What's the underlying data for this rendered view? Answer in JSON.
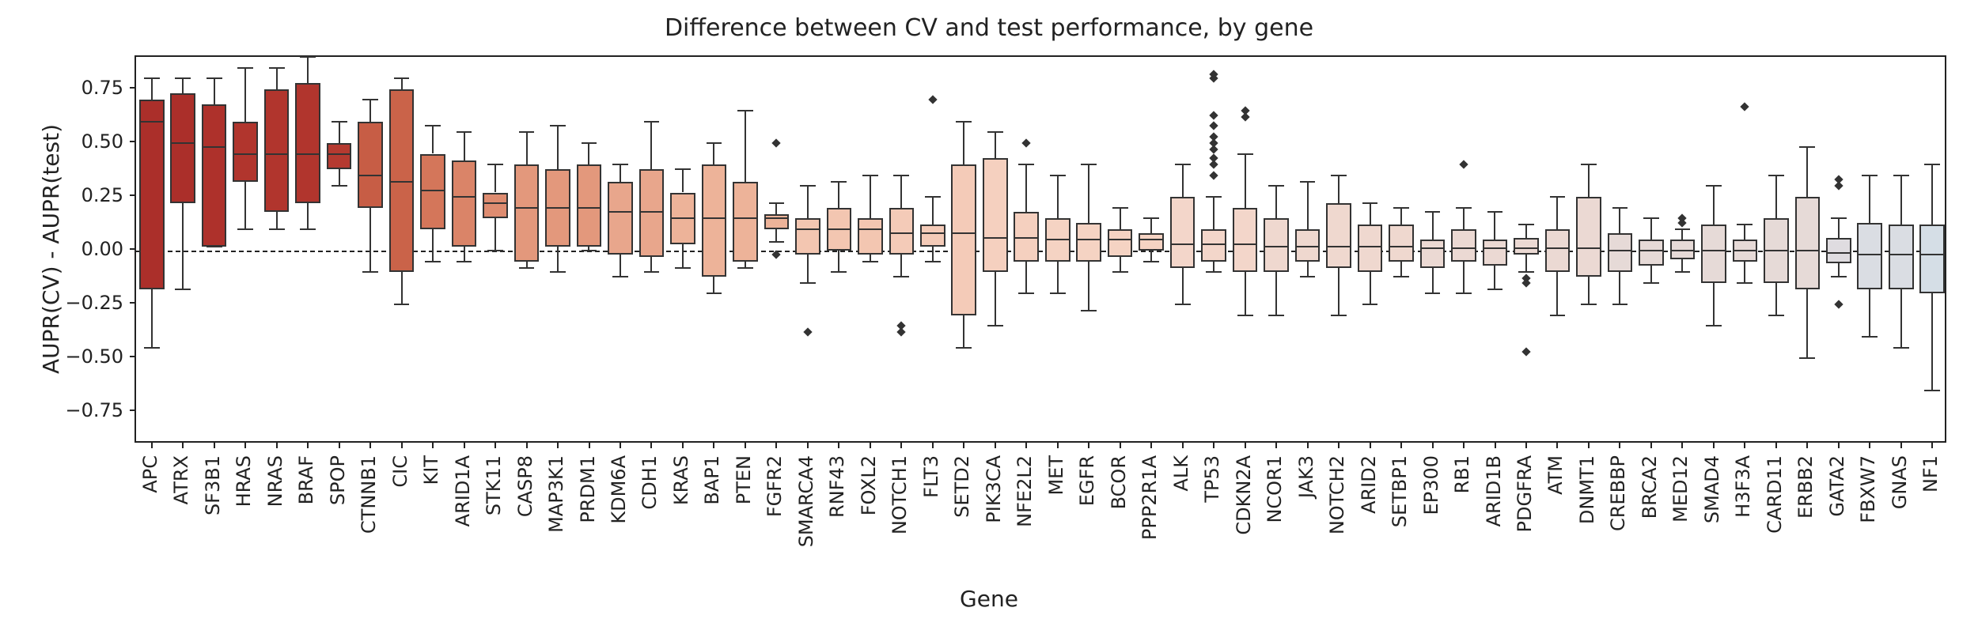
{
  "chart_data": {
    "type": "boxplot",
    "title": "Difference between CV and test performance, by gene",
    "xlabel": "Gene",
    "ylabel": "AUPR(CV) - AUPR(test)",
    "ylim": [
      -0.9,
      0.9
    ],
    "yticks": [
      -0.75,
      -0.5,
      -0.25,
      0.0,
      0.25,
      0.5,
      0.75
    ],
    "ytick_labels": [
      "−0.75",
      "−0.50",
      "−0.25",
      "0.00",
      "0.25",
      "0.50",
      "0.75"
    ],
    "categories": [
      "APC",
      "ATRX",
      "SF3B1",
      "HRAS",
      "NRAS",
      "BRAF",
      "SPOP",
      "CTNNB1",
      "CIC",
      "KIT",
      "ARID1A",
      "STK11",
      "CASP8",
      "MAP3K1",
      "PRDM1",
      "KDM6A",
      "CDH1",
      "KRAS",
      "BAP1",
      "PTEN",
      "FGFR2",
      "SMARCA4",
      "RNF43",
      "FOXL2",
      "NOTCH1",
      "FLT3",
      "SETD2",
      "PIK3CA",
      "NFE2L2",
      "MET",
      "EGFR",
      "BCOR",
      "PPP2R1A",
      "ALK",
      "TP53",
      "CDKN2A",
      "NCOR1",
      "JAK3",
      "NOTCH2",
      "ARID2",
      "SETBP1",
      "EP300",
      "RB1",
      "ARID1B",
      "PDGFRA",
      "ATM",
      "DNMT1",
      "CREBBP",
      "BRCA2",
      "MED12",
      "SMAD4",
      "H3F3A",
      "CARD11",
      "ERBB2",
      "GATA2",
      "FBXW7",
      "GNAS",
      "NF1"
    ],
    "series": [
      {
        "lw": -0.45,
        "q1": -0.18,
        "med": 0.6,
        "q3": 0.7,
        "uw": 0.8,
        "outliers": [],
        "color": "#ab2f2a"
      },
      {
        "lw": -0.18,
        "q1": 0.22,
        "med": 0.5,
        "q3": 0.73,
        "uw": 0.8,
        "outliers": [],
        "color": "#ab2f2a"
      },
      {
        "lw": 0.02,
        "q1": 0.02,
        "med": 0.48,
        "q3": 0.68,
        "uw": 0.8,
        "outliers": [],
        "color": "#ae312b"
      },
      {
        "lw": 0.1,
        "q1": 0.32,
        "med": 0.45,
        "q3": 0.6,
        "uw": 0.85,
        "outliers": [],
        "color": "#b1352d"
      },
      {
        "lw": 0.1,
        "q1": 0.18,
        "med": 0.45,
        "q3": 0.75,
        "uw": 0.85,
        "outliers": [],
        "color": "#b1352d"
      },
      {
        "lw": 0.1,
        "q1": 0.22,
        "med": 0.45,
        "q3": 0.78,
        "uw": 0.9,
        "outliers": [],
        "color": "#b1352d"
      },
      {
        "lw": 0.3,
        "q1": 0.38,
        "med": 0.45,
        "q3": 0.5,
        "uw": 0.6,
        "outliers": [],
        "color": "#b53a30"
      },
      {
        "lw": -0.1,
        "q1": 0.2,
        "med": 0.35,
        "q3": 0.6,
        "uw": 0.7,
        "outliers": [],
        "color": "#c75d45"
      },
      {
        "lw": -0.25,
        "q1": -0.1,
        "med": 0.32,
        "q3": 0.75,
        "uw": 0.8,
        "outliers": [],
        "color": "#ca6349"
      },
      {
        "lw": -0.05,
        "q1": 0.1,
        "med": 0.28,
        "q3": 0.45,
        "uw": 0.58,
        "outliers": [],
        "color": "#d4765a"
      },
      {
        "lw": -0.05,
        "q1": 0.02,
        "med": 0.25,
        "q3": 0.42,
        "uw": 0.55,
        "outliers": [],
        "color": "#da8468"
      },
      {
        "lw": 0.0,
        "q1": 0.15,
        "med": 0.22,
        "q3": 0.27,
        "uw": 0.4,
        "outliers": [],
        "color": "#de8c70"
      },
      {
        "lw": -0.08,
        "q1": -0.05,
        "med": 0.2,
        "q3": 0.4,
        "uw": 0.55,
        "outliers": [],
        "color": "#e3987c"
      },
      {
        "lw": -0.1,
        "q1": 0.02,
        "med": 0.2,
        "q3": 0.38,
        "uw": 0.58,
        "outliers": [],
        "color": "#e3987c"
      },
      {
        "lw": 0.0,
        "q1": 0.02,
        "med": 0.2,
        "q3": 0.4,
        "uw": 0.5,
        "outliers": [],
        "color": "#e3987c"
      },
      {
        "lw": -0.12,
        "q1": -0.02,
        "med": 0.18,
        "q3": 0.32,
        "uw": 0.4,
        "outliers": [],
        "color": "#e8a68c"
      },
      {
        "lw": -0.1,
        "q1": -0.03,
        "med": 0.18,
        "q3": 0.38,
        "uw": 0.6,
        "outliers": [],
        "color": "#e8a68c"
      },
      {
        "lw": -0.08,
        "q1": 0.03,
        "med": 0.15,
        "q3": 0.27,
        "uw": 0.38,
        "outliers": [],
        "color": "#edb399"
      },
      {
        "lw": -0.2,
        "q1": -0.12,
        "med": 0.15,
        "q3": 0.4,
        "uw": 0.5,
        "outliers": [],
        "color": "#edb399"
      },
      {
        "lw": -0.08,
        "q1": -0.05,
        "med": 0.15,
        "q3": 0.32,
        "uw": 0.65,
        "outliers": [],
        "color": "#edb399"
      },
      {
        "lw": 0.04,
        "q1": 0.1,
        "med": 0.15,
        "q3": 0.17,
        "uw": 0.22,
        "outliers": [
          -0.02,
          0.5
        ],
        "color": "#edb399"
      },
      {
        "lw": -0.15,
        "q1": -0.02,
        "med": 0.1,
        "q3": 0.15,
        "uw": 0.3,
        "outliers": [
          -0.38
        ],
        "color": "#f3c6b1"
      },
      {
        "lw": -0.1,
        "q1": 0.0,
        "med": 0.1,
        "q3": 0.2,
        "uw": 0.32,
        "outliers": [],
        "color": "#f3c6b1"
      },
      {
        "lw": -0.05,
        "q1": -0.02,
        "med": 0.1,
        "q3": 0.15,
        "uw": 0.35,
        "outliers": [],
        "color": "#f3c6b1"
      },
      {
        "lw": -0.12,
        "q1": -0.02,
        "med": 0.08,
        "q3": 0.2,
        "uw": 0.35,
        "outliers": [
          -0.38,
          -0.35
        ],
        "color": "#f4cbb8"
      },
      {
        "lw": -0.05,
        "q1": 0.02,
        "med": 0.08,
        "q3": 0.12,
        "uw": 0.25,
        "outliers": [
          0.7
        ],
        "color": "#f4cbb8"
      },
      {
        "lw": -0.45,
        "q1": -0.3,
        "med": 0.08,
        "q3": 0.4,
        "uw": 0.6,
        "outliers": [],
        "color": "#f4cbb8"
      },
      {
        "lw": -0.35,
        "q1": -0.1,
        "med": 0.06,
        "q3": 0.43,
        "uw": 0.55,
        "outliers": [],
        "color": "#f5d0bf"
      },
      {
        "lw": -0.2,
        "q1": -0.05,
        "med": 0.06,
        "q3": 0.18,
        "uw": 0.4,
        "outliers": [
          0.5
        ],
        "color": "#f5d0bf"
      },
      {
        "lw": -0.2,
        "q1": -0.05,
        "med": 0.05,
        "q3": 0.15,
        "uw": 0.35,
        "outliers": [],
        "color": "#f5d3c3"
      },
      {
        "lw": -0.28,
        "q1": -0.05,
        "med": 0.05,
        "q3": 0.13,
        "uw": 0.4,
        "outliers": [],
        "color": "#f5d3c3"
      },
      {
        "lw": -0.1,
        "q1": -0.03,
        "med": 0.05,
        "q3": 0.1,
        "uw": 0.2,
        "outliers": [],
        "color": "#f5d3c3"
      },
      {
        "lw": -0.05,
        "q1": 0.0,
        "med": 0.05,
        "q3": 0.08,
        "uw": 0.15,
        "outliers": [],
        "color": "#f5d3c3"
      },
      {
        "lw": -0.25,
        "q1": -0.08,
        "med": 0.03,
        "q3": 0.25,
        "uw": 0.4,
        "outliers": [],
        "color": "#f3d6ca"
      },
      {
        "lw": -0.1,
        "q1": -0.05,
        "med": 0.03,
        "q3": 0.1,
        "uw": 0.25,
        "outliers": [
          0.35,
          0.4,
          0.43,
          0.47,
          0.5,
          0.53,
          0.58,
          0.63,
          0.8,
          0.82
        ],
        "color": "#f3d6ca"
      },
      {
        "lw": -0.3,
        "q1": -0.1,
        "med": 0.03,
        "q3": 0.2,
        "uw": 0.45,
        "outliers": [
          0.62,
          0.65
        ],
        "color": "#f3d6ca"
      },
      {
        "lw": -0.3,
        "q1": -0.1,
        "med": 0.02,
        "q3": 0.15,
        "uw": 0.3,
        "outliers": [],
        "color": "#efd8cf"
      },
      {
        "lw": -0.12,
        "q1": -0.05,
        "med": 0.02,
        "q3": 0.1,
        "uw": 0.32,
        "outliers": [],
        "color": "#efd8cf"
      },
      {
        "lw": -0.3,
        "q1": -0.08,
        "med": 0.02,
        "q3": 0.22,
        "uw": 0.35,
        "outliers": [],
        "color": "#efd8cf"
      },
      {
        "lw": -0.25,
        "q1": -0.1,
        "med": 0.02,
        "q3": 0.12,
        "uw": 0.22,
        "outliers": [],
        "color": "#efd8cf"
      },
      {
        "lw": -0.12,
        "q1": -0.05,
        "med": 0.02,
        "q3": 0.12,
        "uw": 0.2,
        "outliers": [],
        "color": "#efd8cf"
      },
      {
        "lw": -0.2,
        "q1": -0.08,
        "med": 0.01,
        "q3": 0.05,
        "uw": 0.18,
        "outliers": [],
        "color": "#ebd9d3"
      },
      {
        "lw": -0.2,
        "q1": -0.05,
        "med": 0.01,
        "q3": 0.1,
        "uw": 0.2,
        "outliers": [
          0.4
        ],
        "color": "#ebd9d3"
      },
      {
        "lw": -0.18,
        "q1": -0.07,
        "med": 0.01,
        "q3": 0.05,
        "uw": 0.18,
        "outliers": [],
        "color": "#ebd9d3"
      },
      {
        "lw": -0.1,
        "q1": -0.02,
        "med": 0.01,
        "q3": 0.06,
        "uw": 0.12,
        "outliers": [
          -0.13,
          -0.15,
          -0.47
        ],
        "color": "#ebd9d3"
      },
      {
        "lw": -0.3,
        "q1": -0.1,
        "med": 0.01,
        "q3": 0.1,
        "uw": 0.25,
        "outliers": [],
        "color": "#ebd9d3"
      },
      {
        "lw": -0.25,
        "q1": -0.12,
        "med": 0.01,
        "q3": 0.25,
        "uw": 0.4,
        "outliers": [],
        "color": "#ebd9d3"
      },
      {
        "lw": -0.25,
        "q1": -0.1,
        "med": 0.0,
        "q3": 0.08,
        "uw": 0.2,
        "outliers": [],
        "color": "#e6dad7"
      },
      {
        "lw": -0.15,
        "q1": -0.07,
        "med": 0.0,
        "q3": 0.05,
        "uw": 0.15,
        "outliers": [],
        "color": "#e6dad7"
      },
      {
        "lw": -0.1,
        "q1": -0.04,
        "med": 0.0,
        "q3": 0.05,
        "uw": 0.1,
        "outliers": [
          0.13,
          0.15
        ],
        "color": "#e6dad7"
      },
      {
        "lw": -0.35,
        "q1": -0.15,
        "med": 0.0,
        "q3": 0.12,
        "uw": 0.3,
        "outliers": [],
        "color": "#e6dad7"
      },
      {
        "lw": -0.15,
        "q1": -0.05,
        "med": 0.0,
        "q3": 0.05,
        "uw": 0.12,
        "outliers": [
          0.67
        ],
        "color": "#e6dad7"
      },
      {
        "lw": -0.3,
        "q1": -0.15,
        "med": 0.0,
        "q3": 0.15,
        "uw": 0.35,
        "outliers": [],
        "color": "#e6dad7"
      },
      {
        "lw": -0.5,
        "q1": -0.18,
        "med": 0.0,
        "q3": 0.25,
        "uw": 0.48,
        "outliers": [],
        "color": "#e6dad7"
      },
      {
        "lw": -0.12,
        "q1": -0.06,
        "med": -0.01,
        "q3": 0.06,
        "uw": 0.15,
        "outliers": [
          -0.25,
          0.3,
          0.33
        ],
        "color": "#dfdce0"
      },
      {
        "lw": -0.4,
        "q1": -0.18,
        "med": -0.02,
        "q3": 0.13,
        "uw": 0.35,
        "outliers": [],
        "color": "#dadde3"
      },
      {
        "lw": -0.45,
        "q1": -0.18,
        "med": -0.02,
        "q3": 0.12,
        "uw": 0.35,
        "outliers": [],
        "color": "#dadde3"
      },
      {
        "lw": -0.65,
        "q1": -0.2,
        "med": -0.02,
        "q3": 0.12,
        "uw": 0.4,
        "outliers": [],
        "color": "#d5dee6"
      }
    ]
  }
}
